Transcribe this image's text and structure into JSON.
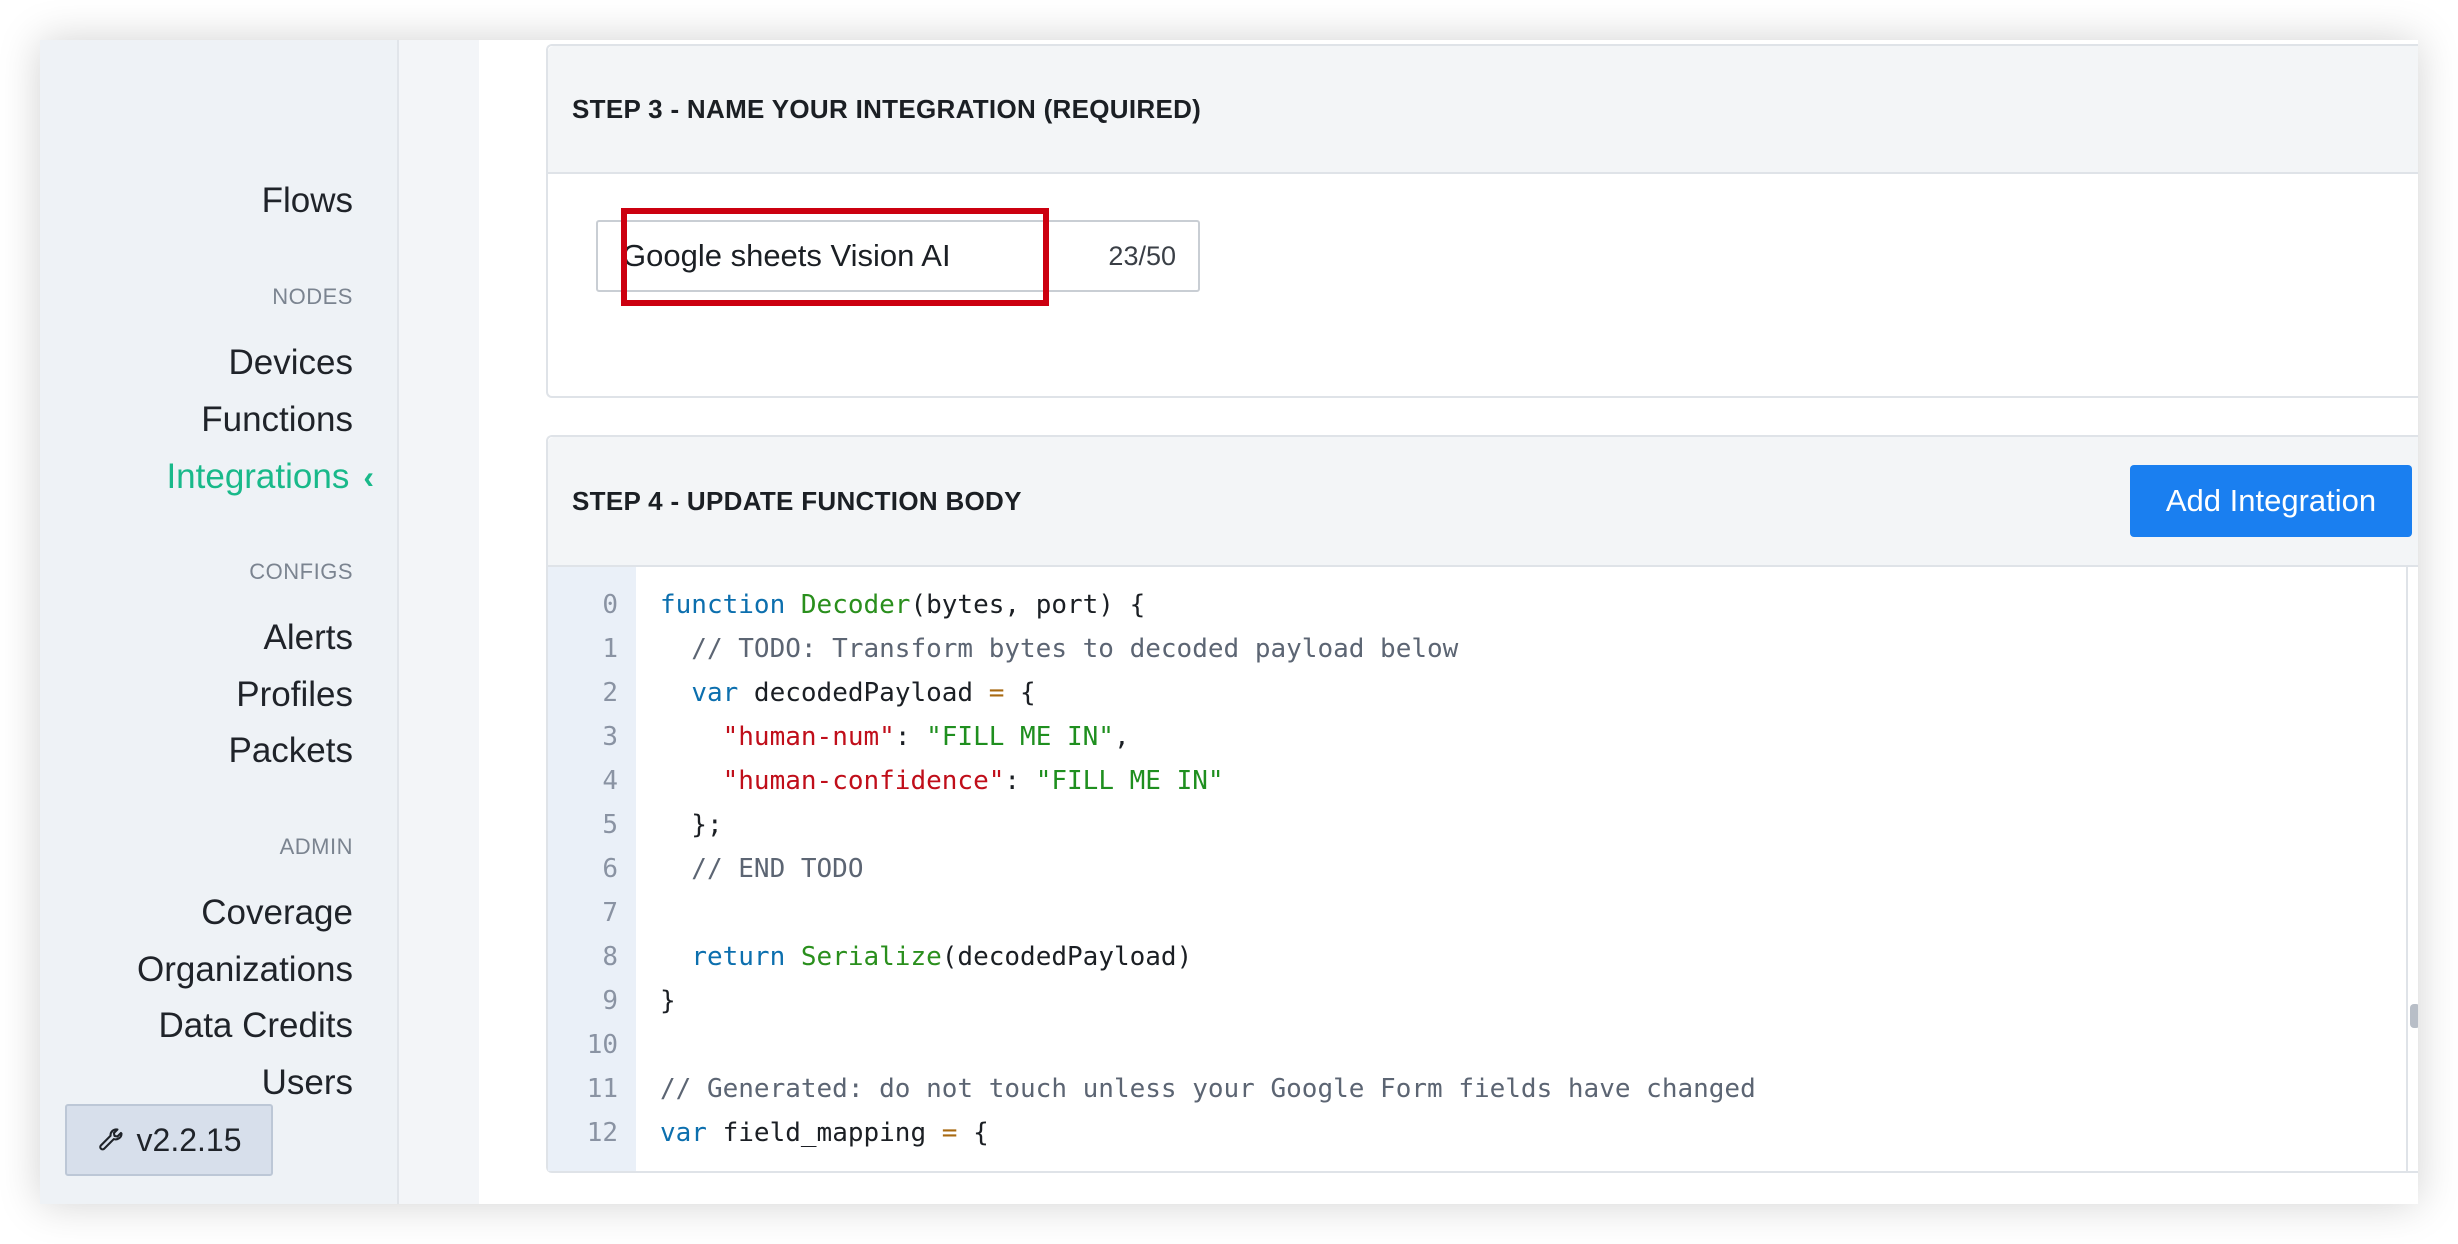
{
  "sidebar": {
    "flows": "Flows",
    "nodes_label": "NODES",
    "devices": "Devices",
    "functions": "Functions",
    "integrations": "Integrations",
    "configs_label": "CONFIGS",
    "alerts": "Alerts",
    "profiles": "Profiles",
    "packets": "Packets",
    "admin_label": "ADMIN",
    "coverage": "Coverage",
    "organizations": "Organizations",
    "data_credits": "Data Credits",
    "users": "Users",
    "version": "v2.2.15"
  },
  "step3": {
    "title": "STEP 3 - NAME YOUR INTEGRATION (REQUIRED)",
    "input_value": "Google sheets Vision AI",
    "char_count": "23/50"
  },
  "step4": {
    "title": "STEP 4 - UPDATE FUNCTION BODY",
    "add_button": "Add Integration",
    "code_lines": [
      {
        "n": "0",
        "text": "function Decoder(bytes, port) {"
      },
      {
        "n": "1",
        "text": "  // TODO: Transform bytes to decoded payload below"
      },
      {
        "n": "2",
        "text": "  var decodedPayload = {"
      },
      {
        "n": "3",
        "text": "    \"human-num\": \"FILL ME IN\","
      },
      {
        "n": "4",
        "text": "    \"human-confidence\": \"FILL ME IN\""
      },
      {
        "n": "5",
        "text": "  };"
      },
      {
        "n": "6",
        "text": "  // END TODO"
      },
      {
        "n": "7",
        "text": ""
      },
      {
        "n": "8",
        "text": "  return Serialize(decodedPayload)"
      },
      {
        "n": "9",
        "text": "}"
      },
      {
        "n": "10",
        "text": ""
      },
      {
        "n": "11",
        "text": "// Generated: do not touch unless your Google Form fields have changed"
      },
      {
        "n": "12",
        "text": "var field_mapping = {"
      }
    ]
  },
  "colors": {
    "accent_green": "#19b98a",
    "primary_blue": "#1a7ff0",
    "highlight_red": "#cc0010"
  }
}
